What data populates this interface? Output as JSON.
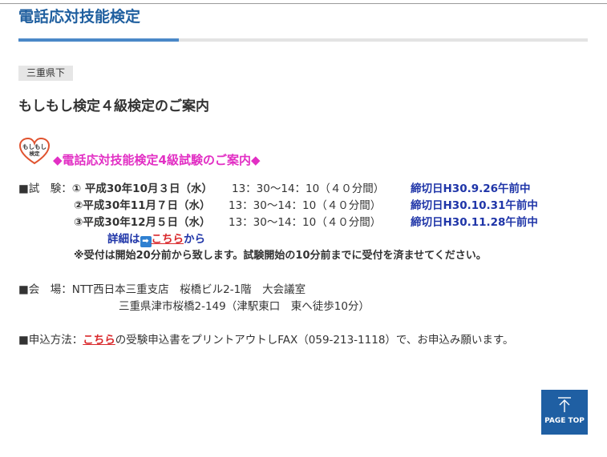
{
  "header": {
    "title": "電話応対技能検定"
  },
  "region_badge": "三重県下",
  "sub_title": "もしもし検定４級検定のご案内",
  "logo": {
    "icon": "moshimoshi-kentei-logo",
    "text_line1": "もしもし",
    "text_line2": "検定"
  },
  "section_heading": "◆電話応対技能検定4級試験のご案内◆",
  "exam": {
    "label": "■試　験：",
    "sessions": [
      {
        "date": "① 平成30年10月３日（水）",
        "time": "13：30～14：10（４０分間）",
        "deadline": "締切日H30.9.26午前中"
      },
      {
        "date": "②平成30年11月７日（水）",
        "time": "13：30～14：10（４０分間）",
        "deadline": "締切日H30.10.31午前中"
      },
      {
        "date": "③平成30年12月５日（水）",
        "time": "13：30～14：10（４０分間）",
        "deadline": "締切日H30.11.28午前中"
      }
    ],
    "detail_prefix": "詳細は",
    "detail_link": "こちら",
    "detail_suffix": "から",
    "note": "※受付は開始20分前から致します。試験開始の10分前までに受付を済ませてください。"
  },
  "venue": {
    "label": "■会　場：",
    "name": "NTT西日本三重支店　桜橋ビル2-1階　大会議室",
    "address": "三重県津市桜橋2-149（津駅東口　東へ徒歩10分）"
  },
  "apply": {
    "label": "■申込方法：",
    "link": "こちら",
    "text": "の受験申込書をプリントアウトしFAX（059-213-1118）で、お申込み願います。"
  },
  "page_top": {
    "label": "PAGE TOP",
    "icon": "arrow-up-icon"
  },
  "colors": {
    "title": "#1f5f9f",
    "accent": "#4a88c8",
    "pink": "#e22fc4",
    "deadline": "#1f35a8",
    "link": "#d9282b",
    "page_top_bg": "#1f5fa3"
  }
}
